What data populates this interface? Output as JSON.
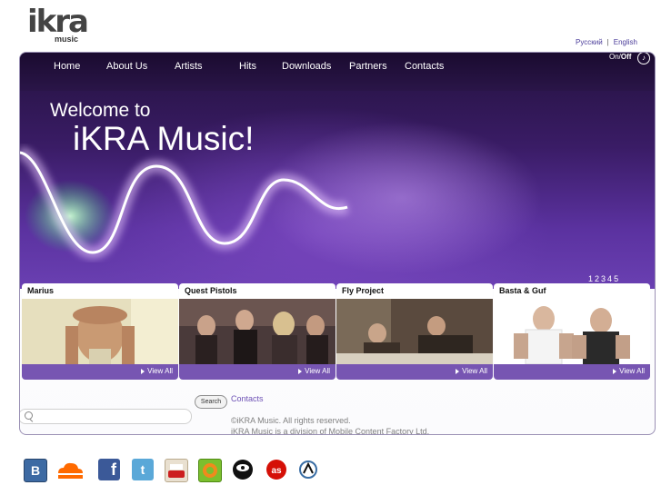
{
  "logo": {
    "main": "ikra",
    "sub": "music"
  },
  "languages": [
    "Русский",
    "English"
  ],
  "nav": [
    "Home",
    "About Us",
    "Artists",
    "Hits",
    "Downloads",
    "Partners",
    "Contacts"
  ],
  "sound_toggle": {
    "on": "On/",
    "off": "Off"
  },
  "hero": {
    "line1": "Welcome to",
    "line2": "iKRA Music!"
  },
  "pager": [
    "1",
    "2",
    "3",
    "4",
    "5"
  ],
  "artists": [
    {
      "name": "Marius",
      "view_all": "View All"
    },
    {
      "name": "Quest Pistols",
      "view_all": "View All"
    },
    {
      "name": "Fly Project",
      "view_all": "View All"
    },
    {
      "name": "Basta & Guf",
      "view_all": "View All"
    }
  ],
  "footer": {
    "search_button": "Search",
    "search_value": "",
    "contacts": "Contacts",
    "copyright": "©iKRA Music. All rights reserved.",
    "division": "iKRA Music is a division of Mobile Content Factory Ltd."
  },
  "social_icons": [
    "blogger-icon",
    "soundcloud-icon",
    "facebook-icon",
    "twitter-icon",
    "youtube-icon",
    "rutube-icon",
    "gramophone-icon",
    "lastfm-icon",
    "vkontakte-icon"
  ],
  "colors": {
    "accent": "#7755b2",
    "hero_dark": "#24123f",
    "link": "#6e52b5"
  }
}
